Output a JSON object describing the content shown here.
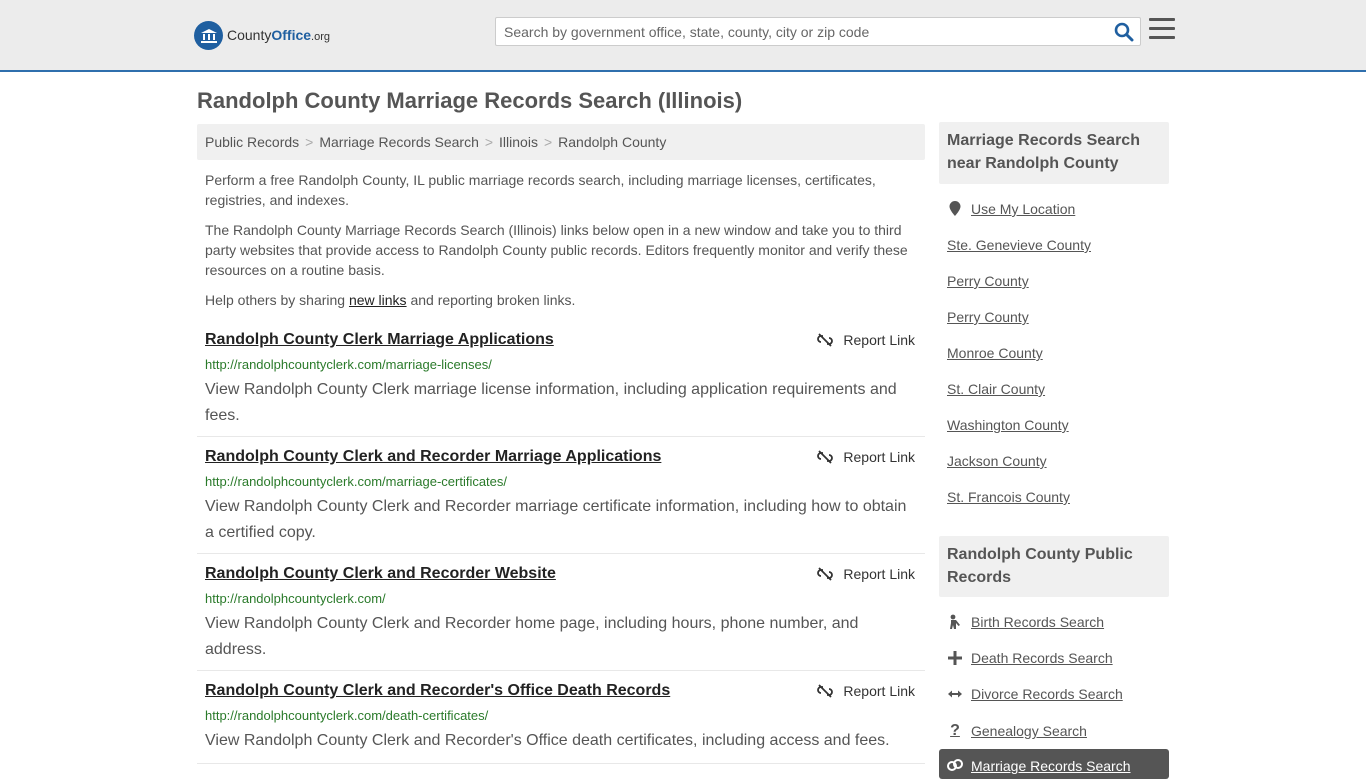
{
  "header": {
    "logo_brand_a": "County",
    "logo_brand_b": "Office",
    "logo_tld": ".org",
    "search_placeholder": "Search by government office, state, county, city or zip code"
  },
  "page_title": "Randolph County Marriage Records Search (Illinois)",
  "breadcrumb": [
    "Public Records",
    "Marriage Records Search",
    "Illinois",
    "Randolph County"
  ],
  "intro": {
    "p1": "Perform a free Randolph County, IL public marriage records search, including marriage licenses, certificates, registries, and indexes.",
    "p2": "The Randolph County Marriage Records Search (Illinois) links below open in a new window and take you to third party websites that provide access to Randolph County public records. Editors frequently monitor and verify these resources on a routine basis.",
    "p3_before": "Help others by sharing ",
    "p3_link": "new links",
    "p3_after": " and reporting broken links."
  },
  "report_label": "Report Link",
  "listings": [
    {
      "title": "Randolph County Clerk Marriage Applications",
      "url": "http://randolphcountyclerk.com/marriage-licenses/",
      "desc": "View Randolph County Clerk marriage license information, including application requirements and fees."
    },
    {
      "title": "Randolph County Clerk and Recorder Marriage Applications",
      "url": "http://randolphcountyclerk.com/marriage-certificates/",
      "desc": "View Randolph County Clerk and Recorder marriage certificate information, including how to obtain a certified copy."
    },
    {
      "title": "Randolph County Clerk and Recorder Website",
      "url": "http://randolphcountyclerk.com/",
      "desc": "View Randolph County Clerk and Recorder home page, including hours, phone number, and address."
    },
    {
      "title": "Randolph County Clerk and Recorder's Office Death Records",
      "url": "http://randolphcountyclerk.com/death-certificates/",
      "desc": "View Randolph County Clerk and Recorder's Office death certificates, including access and fees."
    }
  ],
  "sidebar": {
    "near_heading": "Marriage Records Search near Randolph County",
    "use_location": "Use My Location",
    "near_links": [
      "Ste. Genevieve County",
      "Perry County",
      "Perry County",
      "Monroe County",
      "St. Clair County",
      "Washington County",
      "Jackson County",
      "St. Francois County"
    ],
    "public_heading": "Randolph County Public Records",
    "public_links": [
      "Birth Records Search",
      "Death Records Search",
      "Divorce Records Search",
      "Genealogy Search"
    ],
    "active_link": "Marriage Records Search"
  },
  "colors": {
    "accent": "#2f6fad",
    "url_green": "#2a7a2a",
    "text": "#555555"
  }
}
